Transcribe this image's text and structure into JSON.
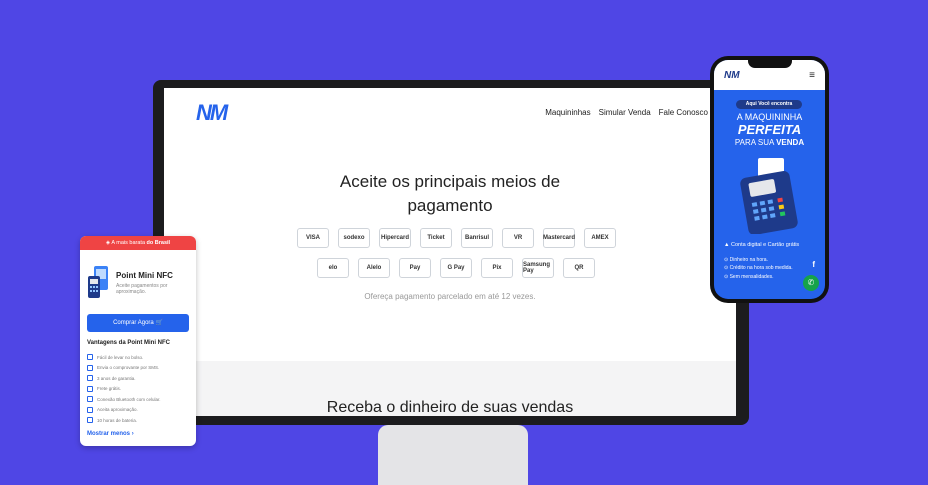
{
  "desktop": {
    "logo": "NM",
    "nav": [
      "Maquininhas",
      "Simular Venda",
      "Fale Conosco"
    ],
    "hero_title_line1": "Aceite os principais meios de",
    "hero_title_line2": "pagamento",
    "payments_row1": [
      "VISA",
      "sodexo",
      "Hipercard",
      "Ticket",
      "Banrisul",
      "VR",
      "Mastercard",
      "AMEX"
    ],
    "payments_row2": [
      "elo",
      "Alelo",
      "Pay",
      "G Pay",
      "Pix",
      "Samsung Pay",
      "QR"
    ],
    "parcel_text": "Ofereça pagamento parcelado em até 12 vezes.",
    "section2_title": "Receba o dinheiro de suas vendas"
  },
  "phone": {
    "logo": "NM",
    "badge": "Aqui Você encontra",
    "line1": "A MAQUININHA",
    "line2": "PERFEITA",
    "line3a": "PARA SUA ",
    "line3b": "VENDA",
    "features": [
      "Conta digital e Cartão grátis",
      "Dinheiro na hora.",
      "Crédito na hora sob medida.",
      "Sem mensalidades."
    ],
    "facebook": "f",
    "whatsapp": "✆"
  },
  "card": {
    "top_prefix": "A mais barata ",
    "top_strong": "do Brasil",
    "title": "Point Mini NFC",
    "subtitle": "Aceite pagamentos por aproximação.",
    "buy_button": "Comprar Agora",
    "section_title": "Vantagens da Point Mini NFC",
    "features": [
      "Fácil de levar no bolso.",
      "Envia o comprovante por SMS.",
      "3 anos de garantia.",
      "Frete grátis.",
      "Conexão Bluetooth com celular.",
      "Aceita aproximação.",
      "10 horas de bateria."
    ],
    "show_more": "Mostrar menos"
  }
}
